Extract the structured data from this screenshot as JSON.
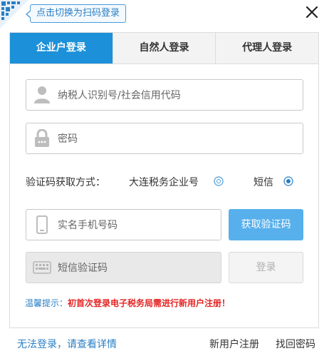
{
  "qr": {
    "tip": "点击切换为扫码登录",
    "corner_icon": "qr-code-icon",
    "close_icon": "close-icon"
  },
  "tabs": [
    {
      "label": "企业户登录",
      "active": true
    },
    {
      "label": "自然人登录",
      "active": false
    },
    {
      "label": "代理人登录",
      "active": false
    }
  ],
  "fields": {
    "taxpayer_id": {
      "placeholder": "纳税人识别号/社会信用代码",
      "icon": "user-icon"
    },
    "password": {
      "placeholder": "密码",
      "icon": "lock-icon"
    },
    "phone": {
      "placeholder": "实名手机号码",
      "icon": "phone-icon"
    },
    "sms_code": {
      "placeholder": "短信验证码",
      "icon": "keyboard-icon"
    }
  },
  "verify": {
    "label": "验证码获取方式：",
    "options": [
      {
        "label": "大连税务企业号",
        "selected": false
      },
      {
        "label": "短信",
        "selected": true
      }
    ]
  },
  "buttons": {
    "get_code": "获取验证码",
    "login": "登录"
  },
  "notice": {
    "key": "温馨提示：",
    "message": "初首次登录电子税务局需进行新用户注册！"
  },
  "footer": {
    "help": "无法登录，请查看详情",
    "register": "新用户注册",
    "recover": "找回密码"
  },
  "colors": {
    "primary": "#1c90d8",
    "button_blue": "#57b0ec",
    "link": "#2a7fc4",
    "warning": "#e52424"
  }
}
